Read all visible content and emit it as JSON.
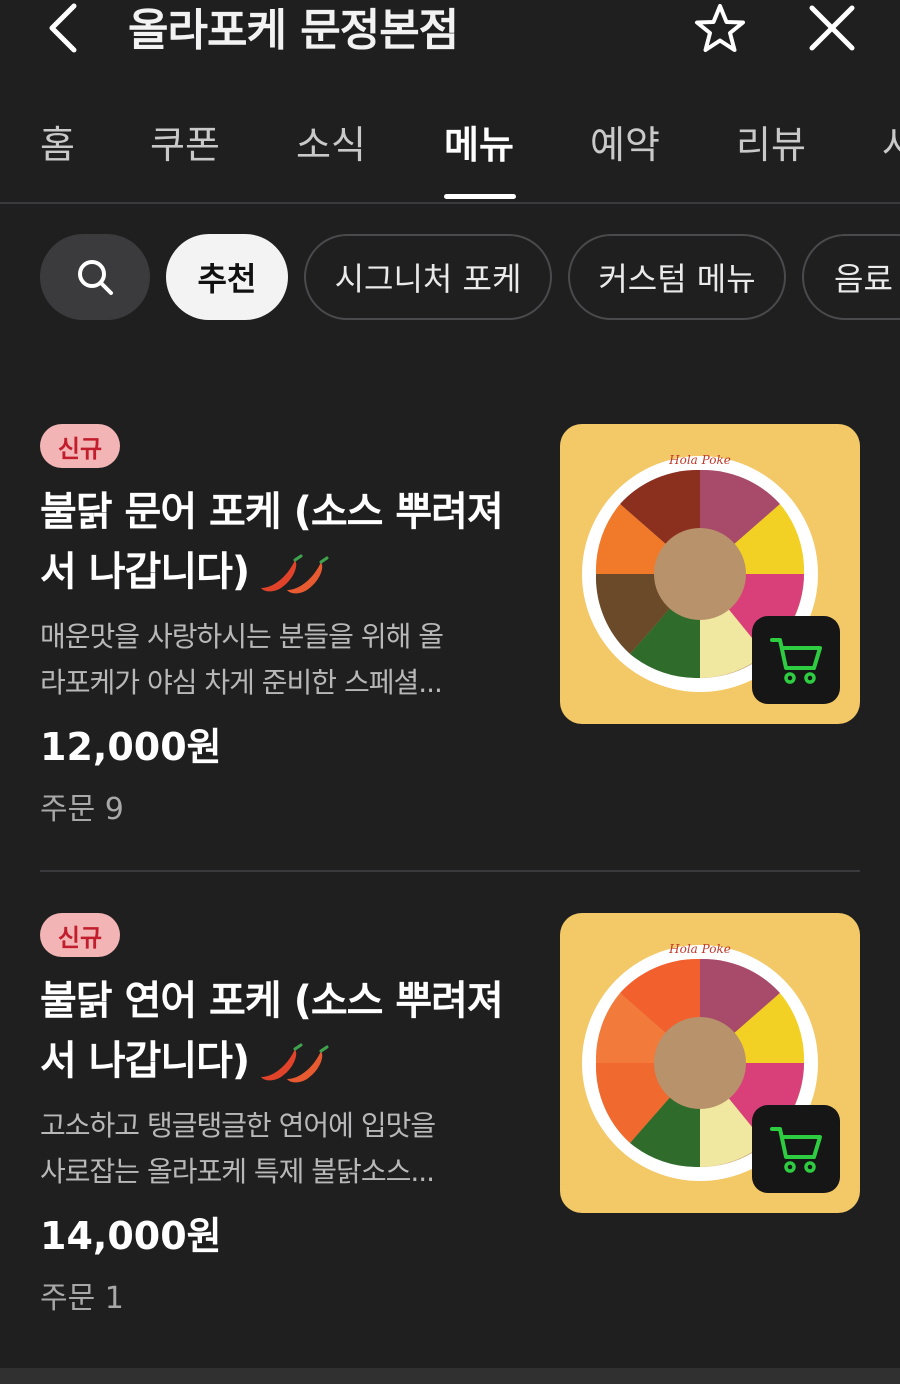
{
  "header": {
    "title": "올라포케 문정본점",
    "back_icon": "chevron-left-icon",
    "favorite_icon": "star-outline-icon",
    "close_icon": "close-icon"
  },
  "tabs": [
    {
      "label": "홈"
    },
    {
      "label": "쿠폰"
    },
    {
      "label": "소식"
    },
    {
      "label": "메뉴",
      "active": true
    },
    {
      "label": "예약"
    },
    {
      "label": "리뷰"
    },
    {
      "label": "사"
    }
  ],
  "chips": {
    "search_icon": "search-icon",
    "items": [
      {
        "label": "추천",
        "active": true
      },
      {
        "label": "시그니처 포케"
      },
      {
        "label": "커스텀 메뉴"
      },
      {
        "label": "음료"
      }
    ]
  },
  "menu_items": [
    {
      "badge": "신규",
      "name": "불닭 문어 포케 (소스 뿌려져서 나갑니다)",
      "spicy_icon": "chili-pepper-icon",
      "description_line1": "매운맛을 사랑하시는 분들을 위해 올",
      "description_line2": "라포케가 야심 차게 준비한 스페셜...",
      "price": "12,000원",
      "orders": "주문 9",
      "bowl_rim_text": "Hola Poke"
    },
    {
      "badge": "신규",
      "name": "불닭 연어 포케 (소스 뿌려져서 나갑니다)",
      "spicy_icon": "chili-pepper-icon",
      "description_line1": "고소하고 탱글탱글한 연어에 입맛을",
      "description_line2": "사로잡는 올라포케 특제 불닭소스...",
      "price": "14,000원",
      "orders": "주문 1",
      "bowl_rim_text": "Hola Poke"
    }
  ],
  "colors": {
    "background": "#1f1f20",
    "badge_bg": "#f2b4b4",
    "badge_text": "#c11d2c",
    "cart_green": "#2ecc40",
    "thumb_bg": "#f3c867"
  }
}
